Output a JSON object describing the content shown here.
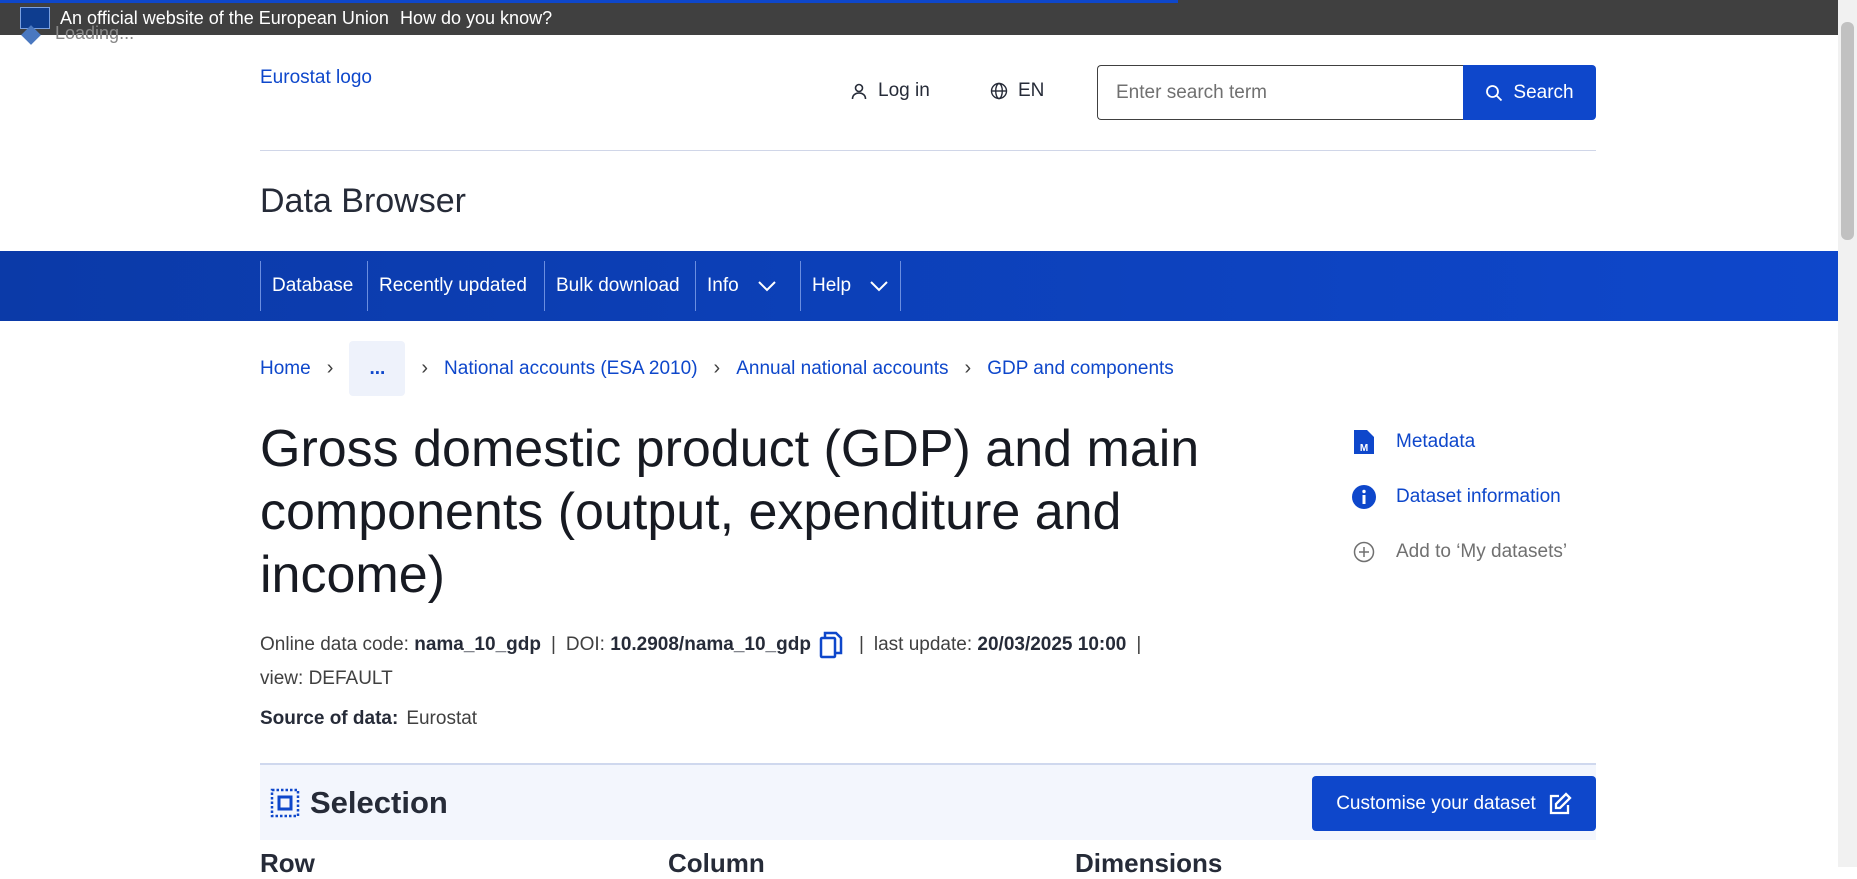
{
  "eu_bar": {
    "official": "An official website of the European Union",
    "how": "How do you know?",
    "loading": "Loading..."
  },
  "header": {
    "logo_alt": "Eurostat logo",
    "login": "Log in",
    "language": "EN",
    "search_placeholder": "Enter search term",
    "search_button": "Search",
    "app_title": "Data Browser"
  },
  "nav": {
    "items": [
      {
        "label": "Database"
      },
      {
        "label": "Recently updated"
      },
      {
        "label": "Bulk download"
      },
      {
        "label": "Info"
      },
      {
        "label": "Help"
      }
    ]
  },
  "breadcrumb": {
    "home": "Home",
    "ellipsis": "...",
    "items": [
      "National accounts (ESA 2010)",
      "Annual national accounts",
      "GDP and components"
    ]
  },
  "dataset": {
    "title": "Gross domestic product (GDP) and main components (output, expenditure and income)",
    "code_label": "Online data code:",
    "code": "nama_10_gdp",
    "doi_label": "DOI:",
    "doi": "10.2908/nama_10_gdp",
    "update_label": "last update:",
    "update": "20/03/2025 10:00",
    "view": "view: DEFAULT",
    "source_label": "Source of data:",
    "source": "Eurostat"
  },
  "side_links": {
    "metadata": "Metadata",
    "info": "Dataset information",
    "add": "Add to ‘My datasets’"
  },
  "selection": {
    "title": "Selection",
    "customise": "Customise your dataset",
    "row": "Row",
    "column": "Column",
    "dimensions": "Dimensions"
  },
  "colors": {
    "accent": "#0e47cb",
    "topbar": "#404040"
  }
}
